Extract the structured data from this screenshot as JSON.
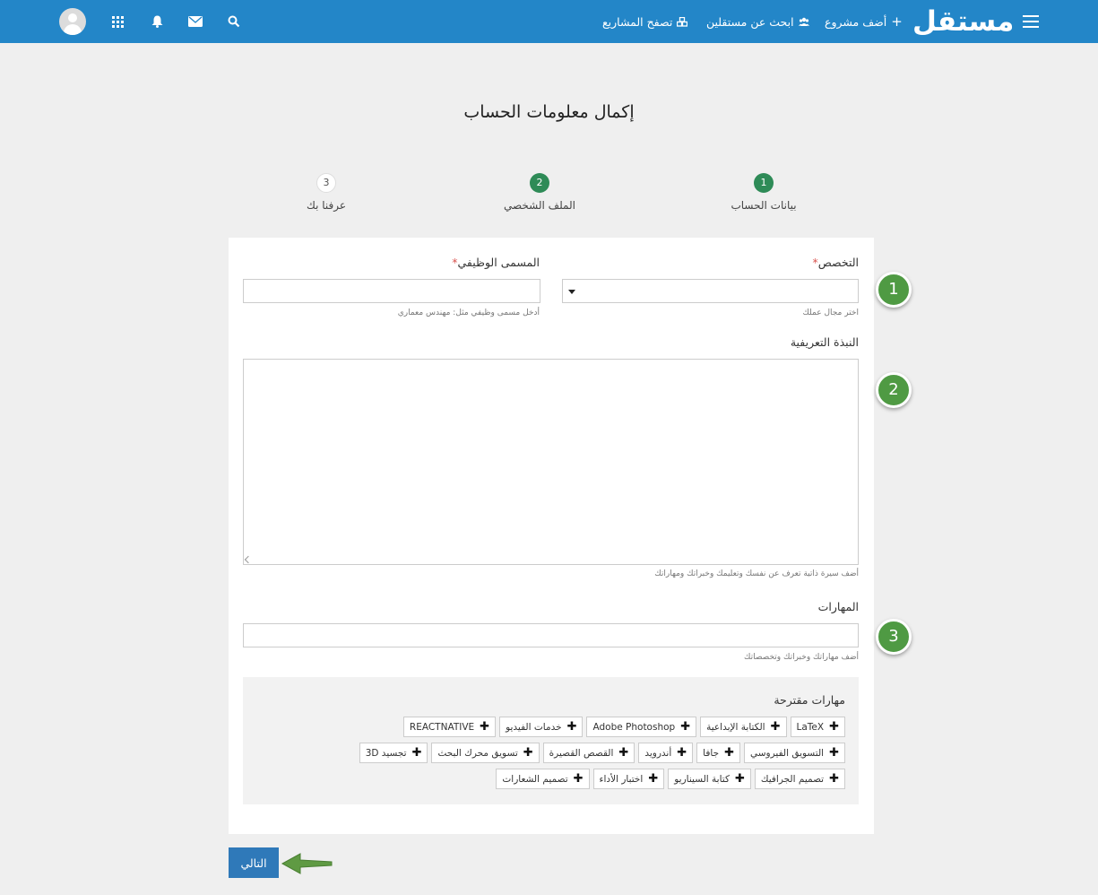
{
  "navbar": {
    "logo": "مستقل",
    "links": [
      {
        "label": "أضف مشروع",
        "icon": "+"
      },
      {
        "label": "ابحث عن مستقلين",
        "icon": "users-icon"
      },
      {
        "label": "تصفح المشاريع",
        "icon": "cubes-icon"
      }
    ]
  },
  "page": {
    "title": "إكمال معلومات الحساب"
  },
  "steps": [
    {
      "number": "1",
      "label": "بيانات الحساب",
      "state": "completed"
    },
    {
      "number": "2",
      "label": "الملف الشخصي",
      "state": "current"
    },
    {
      "number": "3",
      "label": "عرفنا بك",
      "state": "pending"
    }
  ],
  "form": {
    "specialty": {
      "label": "التخصص",
      "required_mark": "*",
      "value": "",
      "hint": "اختر مجال عملك"
    },
    "job_title": {
      "label": "المسمى الوظيفي",
      "required_mark": "*",
      "value": "",
      "hint": "أدخل مسمى وظيفي مثل: مهندس معماري"
    },
    "bio": {
      "label": "النبذة التعريفية",
      "value": "",
      "hint": "أضف سيرة ذاتية تعرف عن نفسك وتعليمك وخبراتك ومهاراتك"
    },
    "skills": {
      "label": "المهارات",
      "value": "",
      "hint": "أضف مهاراتك وخبراتك وتخصصاتك"
    }
  },
  "suggested_skills": {
    "title": "مهارات مقترحة",
    "items": [
      "LaTeX",
      "الكتابة الإبداعية",
      "Adobe Photoshop",
      "خدمات الفيديو",
      "REACTNATIVE",
      "التسويق الفيروسي",
      "جافا",
      "أندرويد",
      "القصص القصيرة",
      "تسويق محرك البحث",
      "تجسيد 3D",
      "تصميم الجرافيك",
      "كتابة السيناريو",
      "اختبار الأداء",
      "تصميم الشعارات"
    ]
  },
  "annotations": [
    "1",
    "2",
    "3"
  ],
  "next_button": "التالي",
  "colors": {
    "navbar": "#2386c8",
    "step_active": "#2e8b57",
    "badge": "#4f9a43",
    "button": "#2f79b9",
    "required": "#d9534f"
  }
}
